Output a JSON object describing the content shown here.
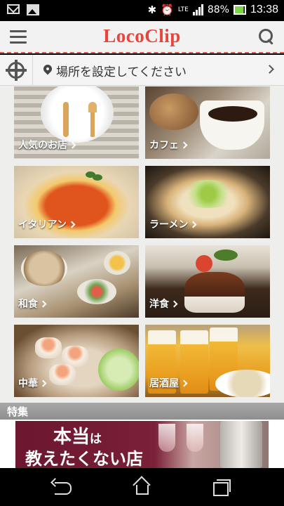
{
  "status_bar": {
    "battery": "88%",
    "network": "LTE",
    "time": "13:38",
    "icons": [
      "mail-icon",
      "picture-icon",
      "bluetooth-icon",
      "alarm-icon",
      "signal-icon",
      "battery-icon"
    ]
  },
  "header": {
    "logo": "LocoClip",
    "accent_color": "#e8453c",
    "icons": [
      "menu-icon",
      "search-icon"
    ]
  },
  "location": {
    "text": "場所を設定してください",
    "icons": [
      "target-icon",
      "pin-icon",
      "chevron-right-icon"
    ]
  },
  "categories": [
    {
      "label": "人気のお店"
    },
    {
      "label": "カフェ"
    },
    {
      "label": "イタリアン"
    },
    {
      "label": "ラーメン"
    },
    {
      "label": "和食"
    },
    {
      "label": "洋食"
    },
    {
      "label": "中華"
    },
    {
      "label": "居酒屋"
    }
  ],
  "special": {
    "title": "特集",
    "banner_line1_big": "本当",
    "banner_line1_small": "は",
    "banner_line2": "教えたくない店"
  },
  "nav": {
    "icons": [
      "back-icon",
      "home-icon",
      "recent-apps-icon"
    ]
  }
}
